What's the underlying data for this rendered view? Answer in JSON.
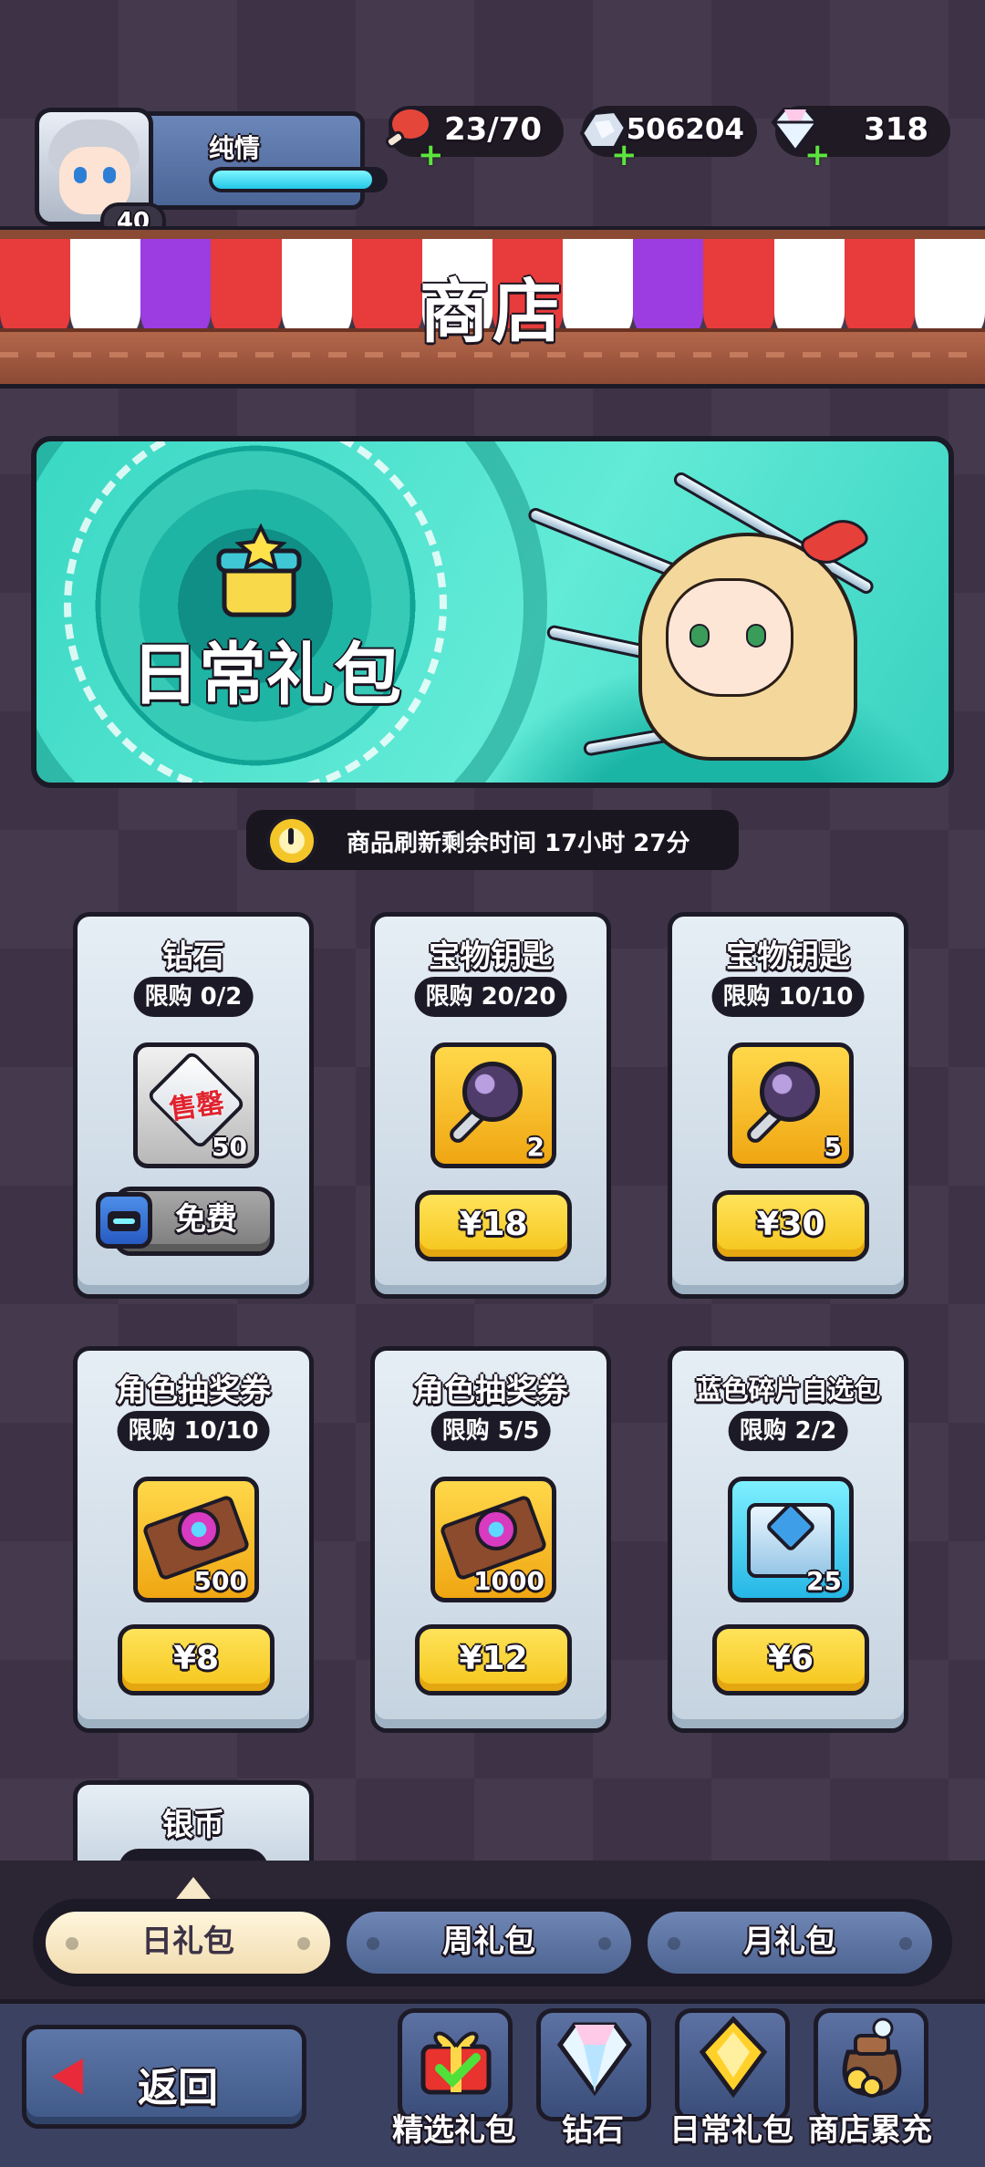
{
  "player": {
    "name": "纯情",
    "level": "40",
    "exp_fraction": 0.93
  },
  "resources": [
    {
      "name": "meat",
      "icon": "meat-icon",
      "value": "23/70"
    },
    {
      "name": "silver",
      "icon": "silver-icon",
      "value": "506204"
    },
    {
      "name": "diamond",
      "icon": "diamond-icon",
      "value": "318"
    }
  ],
  "shop_title": "商店",
  "banner": {
    "title": "日常礼包"
  },
  "refresh": {
    "text": "商品刷新剩余时间 17小时 27分"
  },
  "cards": [
    {
      "name": "钻石",
      "limit": "限购 0/2",
      "qty": "50",
      "sold_out": "售罄",
      "button": "免费",
      "icon": "diamond-icon"
    },
    {
      "name": "宝物钥匙",
      "limit": "限购 20/20",
      "qty": "2",
      "button": "¥18",
      "icon": "key-icon"
    },
    {
      "name": "宝物钥匙",
      "limit": "限购 10/10",
      "qty": "5",
      "button": "¥30",
      "icon": "key-icon"
    },
    {
      "name": "角色抽奖券",
      "limit": "限购 10/10",
      "qty": "500",
      "button": "¥8",
      "icon": "ticket-icon"
    },
    {
      "name": "角色抽奖券",
      "limit": "限购 5/5",
      "qty": "1000",
      "button": "¥12",
      "icon": "ticket-icon"
    },
    {
      "name": "蓝色碎片自选包",
      "limit": "限购 2/2",
      "qty": "25",
      "button": "¥6",
      "icon": "chest-icon"
    },
    {
      "name": "银币"
    }
  ],
  "tabs": [
    {
      "label": "日礼包",
      "active": true
    },
    {
      "label": "周礼包",
      "active": false
    },
    {
      "label": "月礼包",
      "active": false
    }
  ],
  "back_label": "返回",
  "nav": [
    {
      "label": "精选礼包",
      "icon": "gift-icon"
    },
    {
      "label": "钻石",
      "icon": "diamond-icon"
    },
    {
      "label": "日常礼包",
      "icon": "gem-icon"
    },
    {
      "label": "商店累充",
      "icon": "money-bag-icon"
    }
  ],
  "colors": {
    "price_yellow": "#f5c51a",
    "awning_red": "#e83b3b",
    "awning_purple": "#9b3de0",
    "bg": "#3e3346"
  }
}
